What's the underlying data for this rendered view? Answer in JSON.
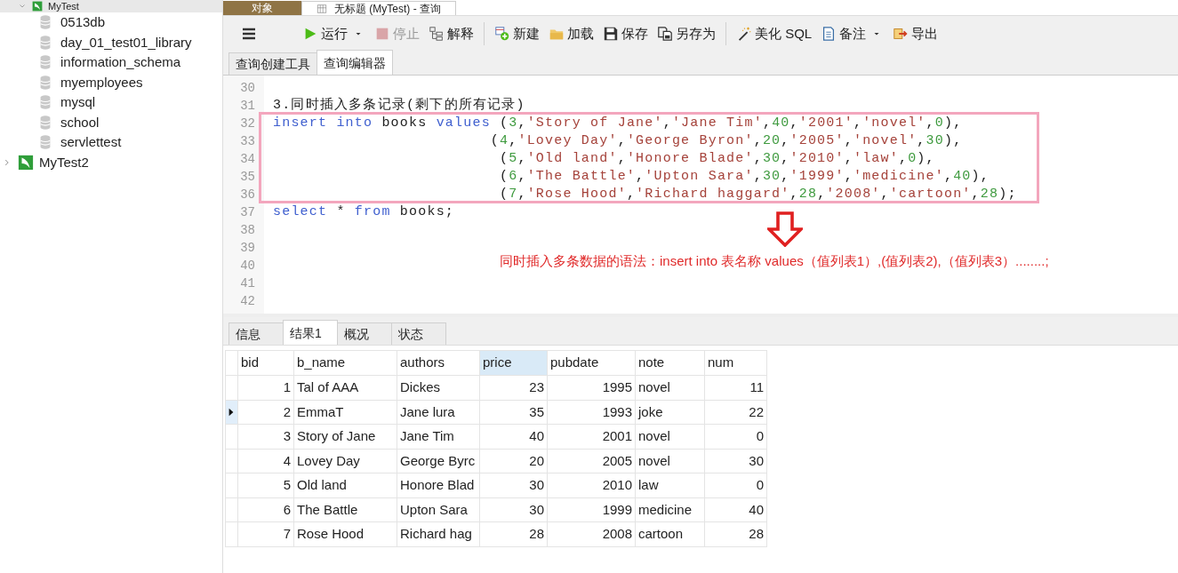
{
  "sidebar": {
    "connections": [
      {
        "label": "MyTest",
        "expanded": true,
        "children": [
          {
            "label": "0513db"
          },
          {
            "label": "day_01_test01_library"
          },
          {
            "label": "information_schema"
          },
          {
            "label": "myemployees"
          },
          {
            "label": "mysql"
          },
          {
            "label": "school"
          },
          {
            "label": "servlettest"
          }
        ]
      },
      {
        "label": "MyTest2",
        "expanded": false
      }
    ]
  },
  "window_tabs": [
    {
      "label": "对象",
      "selected": false
    },
    {
      "label": "无标题 (MyTest) - 查询",
      "selected": true
    }
  ],
  "toolbar": [
    {
      "kind": "menu"
    },
    {
      "kind": "run",
      "label": "运行",
      "has_menu": true,
      "disabled": false
    },
    {
      "kind": "stop",
      "label": "停止",
      "has_menu": false,
      "disabled": true
    },
    {
      "kind": "explain",
      "label": "解释",
      "has_menu": false,
      "disabled": false
    },
    {
      "kind": "new",
      "label": "新建",
      "has_menu": false,
      "disabled": false
    },
    {
      "kind": "load",
      "label": "加载",
      "has_menu": false,
      "disabled": false
    },
    {
      "kind": "save",
      "label": "保存",
      "has_menu": false,
      "disabled": false
    },
    {
      "kind": "saveas",
      "label": "另存为",
      "has_menu": false,
      "disabled": false
    },
    {
      "kind": "beautify",
      "label": "美化 SQL",
      "has_menu": false,
      "disabled": false
    },
    {
      "kind": "note",
      "label": "备注",
      "has_menu": true,
      "disabled": false
    },
    {
      "kind": "export",
      "label": "导出",
      "has_menu": false,
      "disabled": false
    }
  ],
  "editor_tabs": [
    {
      "label": "查询创建工具",
      "selected": false
    },
    {
      "label": "查询编辑器",
      "selected": true
    }
  ],
  "editor": {
    "lines": [
      {
        "number": "30"
      },
      {
        "number": "31",
        "tokens": [
          {
            "kind": "text",
            "text": "3.同时插入多条记录(剩下的所有记录)"
          }
        ]
      },
      {
        "number": "32",
        "tokens": [
          {
            "kind": "keyword",
            "text": "insert into"
          },
          {
            "kind": "text",
            "text": " books "
          },
          {
            "kind": "keyword",
            "text": "values"
          },
          {
            "kind": "text",
            "text": " ("
          },
          {
            "kind": "number",
            "text": "3"
          },
          {
            "kind": "text",
            "text": ","
          },
          {
            "kind": "string",
            "text": "'Story of Jane'"
          },
          {
            "kind": "text",
            "text": ","
          },
          {
            "kind": "string",
            "text": "'Jane Tim'"
          },
          {
            "kind": "text",
            "text": ","
          },
          {
            "kind": "number",
            "text": "40"
          },
          {
            "kind": "text",
            "text": ","
          },
          {
            "kind": "string",
            "text": "'2001'"
          },
          {
            "kind": "text",
            "text": ","
          },
          {
            "kind": "string",
            "text": "'novel'"
          },
          {
            "kind": "text",
            "text": ","
          },
          {
            "kind": "number",
            "text": "0"
          },
          {
            "kind": "text",
            "text": "),"
          }
        ]
      },
      {
        "number": "33",
        "tokens": [
          {
            "kind": "text",
            "text": "                        ("
          },
          {
            "kind": "number",
            "text": "4"
          },
          {
            "kind": "text",
            "text": ","
          },
          {
            "kind": "string",
            "text": "'Lovey Day'"
          },
          {
            "kind": "text",
            "text": ","
          },
          {
            "kind": "string",
            "text": "'George Byron'"
          },
          {
            "kind": "text",
            "text": ","
          },
          {
            "kind": "number",
            "text": "20"
          },
          {
            "kind": "text",
            "text": ","
          },
          {
            "kind": "string",
            "text": "'2005'"
          },
          {
            "kind": "text",
            "text": ","
          },
          {
            "kind": "string",
            "text": "'novel'"
          },
          {
            "kind": "text",
            "text": ","
          },
          {
            "kind": "number",
            "text": "30"
          },
          {
            "kind": "text",
            "text": "),"
          }
        ]
      },
      {
        "number": "34",
        "tokens": [
          {
            "kind": "text",
            "text": "                         ("
          },
          {
            "kind": "number",
            "text": "5"
          },
          {
            "kind": "text",
            "text": ","
          },
          {
            "kind": "string",
            "text": "'Old land'"
          },
          {
            "kind": "text",
            "text": ","
          },
          {
            "kind": "string",
            "text": "'Honore Blade'"
          },
          {
            "kind": "text",
            "text": ","
          },
          {
            "kind": "number",
            "text": "30"
          },
          {
            "kind": "text",
            "text": ","
          },
          {
            "kind": "string",
            "text": "'2010'"
          },
          {
            "kind": "text",
            "text": ","
          },
          {
            "kind": "string",
            "text": "'law'"
          },
          {
            "kind": "text",
            "text": ","
          },
          {
            "kind": "number",
            "text": "0"
          },
          {
            "kind": "text",
            "text": "),"
          }
        ]
      },
      {
        "number": "35",
        "tokens": [
          {
            "kind": "text",
            "text": "                         ("
          },
          {
            "kind": "number",
            "text": "6"
          },
          {
            "kind": "text",
            "text": ","
          },
          {
            "kind": "string",
            "text": "'The Battle'"
          },
          {
            "kind": "text",
            "text": ","
          },
          {
            "kind": "string",
            "text": "'Upton Sara'"
          },
          {
            "kind": "text",
            "text": ","
          },
          {
            "kind": "number",
            "text": "30"
          },
          {
            "kind": "text",
            "text": ","
          },
          {
            "kind": "string",
            "text": "'1999'"
          },
          {
            "kind": "text",
            "text": ","
          },
          {
            "kind": "string",
            "text": "'medicine'"
          },
          {
            "kind": "text",
            "text": ","
          },
          {
            "kind": "number",
            "text": "40"
          },
          {
            "kind": "text",
            "text": "),"
          }
        ]
      },
      {
        "number": "36",
        "tokens": [
          {
            "kind": "text",
            "text": "                         ("
          },
          {
            "kind": "number",
            "text": "7"
          },
          {
            "kind": "text",
            "text": ","
          },
          {
            "kind": "string",
            "text": "'Rose Hood'"
          },
          {
            "kind": "text",
            "text": ","
          },
          {
            "kind": "string",
            "text": "'Richard haggard'"
          },
          {
            "kind": "text",
            "text": ","
          },
          {
            "kind": "number",
            "text": "28"
          },
          {
            "kind": "text",
            "text": ","
          },
          {
            "kind": "string",
            "text": "'2008'"
          },
          {
            "kind": "text",
            "text": ","
          },
          {
            "kind": "string",
            "text": "'cartoon'"
          },
          {
            "kind": "text",
            "text": ","
          },
          {
            "kind": "number",
            "text": "28"
          },
          {
            "kind": "text",
            "text": ");"
          }
        ]
      },
      {
        "number": "37",
        "tokens": [
          {
            "kind": "keyword",
            "text": "select"
          },
          {
            "kind": "text",
            "text": " * "
          },
          {
            "kind": "keyword",
            "text": "from"
          },
          {
            "kind": "text",
            "text": " books;"
          }
        ]
      },
      {
        "number": "38"
      },
      {
        "number": "39"
      },
      {
        "number": "40"
      },
      {
        "number": "41"
      },
      {
        "number": "42"
      }
    ],
    "annotation": "同时插入多条数据的语法：insert into  表名称  values（值列表1）,(值列表2),（值列表3）........;"
  },
  "result_tabs": [
    {
      "label": "信息",
      "selected": false
    },
    {
      "label": "结果1",
      "selected": true
    },
    {
      "label": "概况",
      "selected": false
    },
    {
      "label": "状态",
      "selected": false
    }
  ],
  "table": {
    "columns": [
      {
        "label": "bid",
        "selected": false
      },
      {
        "label": "b_name",
        "selected": false
      },
      {
        "label": "authors",
        "selected": false
      },
      {
        "label": "price",
        "selected": true
      },
      {
        "label": "pubdate",
        "selected": false
      },
      {
        "label": "note",
        "selected": false
      },
      {
        "label": "num",
        "selected": false
      }
    ],
    "rows": [
      {
        "selected": false,
        "cells": [
          "1",
          "Tal of AAA",
          "Dickes",
          "23",
          "1995",
          "novel",
          "11"
        ]
      },
      {
        "selected": true,
        "cells": [
          "2",
          "EmmaT",
          "Jane lura",
          "35",
          "1993",
          "joke",
          "22"
        ]
      },
      {
        "selected": false,
        "cells": [
          "3",
          "Story of Jane",
          "Jane Tim",
          "40",
          "2001",
          "novel",
          "0"
        ]
      },
      {
        "selected": false,
        "cells": [
          "4",
          "Lovey Day",
          "George Byrc",
          "20",
          "2005",
          "novel",
          "30"
        ]
      },
      {
        "selected": false,
        "cells": [
          "5",
          "Old land",
          "Honore Blad",
          "30",
          "2010",
          "law",
          "0"
        ]
      },
      {
        "selected": false,
        "cells": [
          "6",
          "The Battle",
          "Upton Sara",
          "30",
          "1999",
          "medicine",
          "40"
        ]
      },
      {
        "selected": false,
        "cells": [
          "7",
          "Rose Hood",
          "Richard hag",
          "28",
          "2008",
          "cartoon",
          "28"
        ]
      }
    ]
  }
}
